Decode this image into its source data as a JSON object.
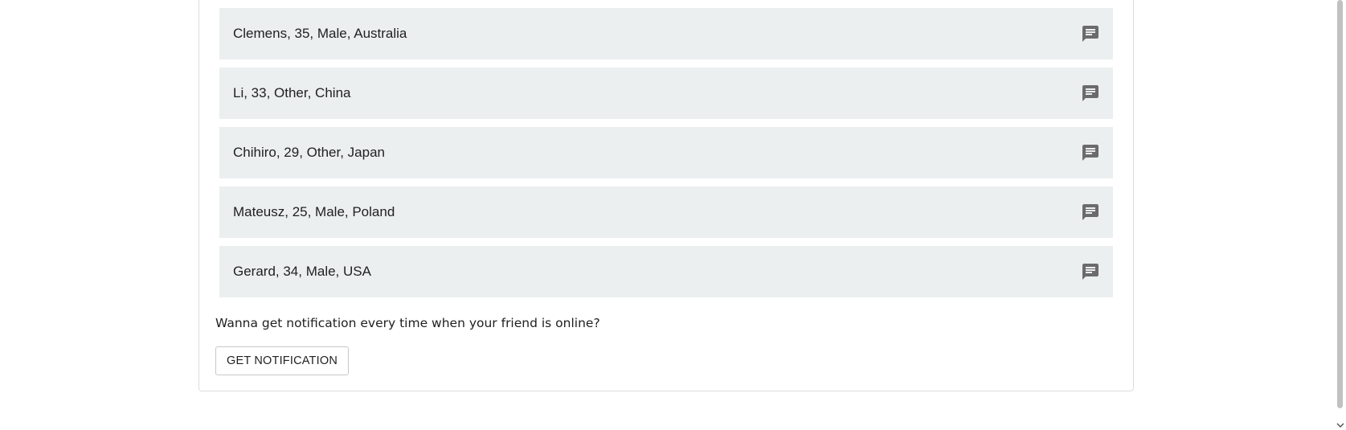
{
  "friends": [
    {
      "label": "Clemens, 35, Male, Australia",
      "action_icon": "chat-icon"
    },
    {
      "label": "Li, 33, Other, China",
      "action_icon": "chat-icon"
    },
    {
      "label": "Chihiro, 29, Other, Japan",
      "action_icon": "chat-icon"
    },
    {
      "label": "Mateusz, 25, Male, Poland",
      "action_icon": "chat-icon"
    },
    {
      "label": "Gerard, 34, Male, USA",
      "action_icon": "chat-icon"
    }
  ],
  "notification": {
    "prompt": "Wanna get notification every time when your friend is online?",
    "button_label": "GET NOTIFICATION"
  },
  "colors": {
    "item_background": "#eceff0",
    "icon_color": "#6b6b6b",
    "text_color": "#212121"
  }
}
